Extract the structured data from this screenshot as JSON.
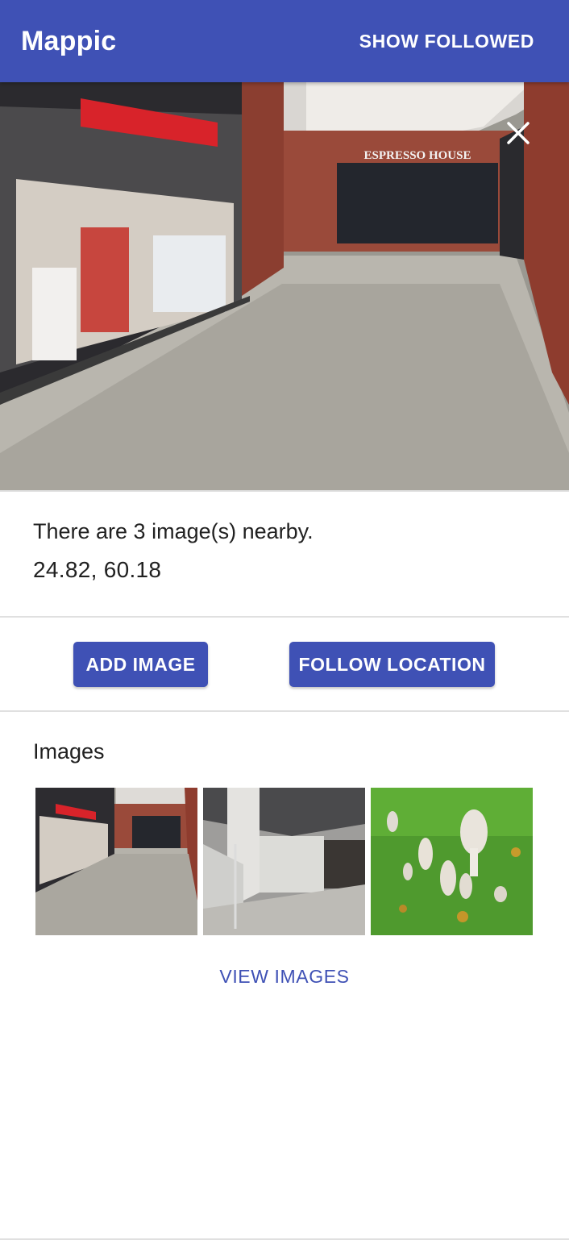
{
  "header": {
    "title": "Mappic",
    "show_followed_label": "SHOW FOLLOWED"
  },
  "hero": {
    "sign_text": "ESPRESSO HOUSE",
    "close_icon": "close-icon"
  },
  "location": {
    "nearby_text": "There are 3 image(s) nearby.",
    "coordinates": "24.82, 60.18"
  },
  "actions": {
    "add_image_label": "ADD IMAGE",
    "follow_location_label": "FOLLOW LOCATION"
  },
  "gallery": {
    "heading": "Images",
    "view_images_label": "VIEW IMAGES"
  },
  "colors": {
    "primary": "#3f51b5",
    "divider": "#e0e0e0"
  }
}
